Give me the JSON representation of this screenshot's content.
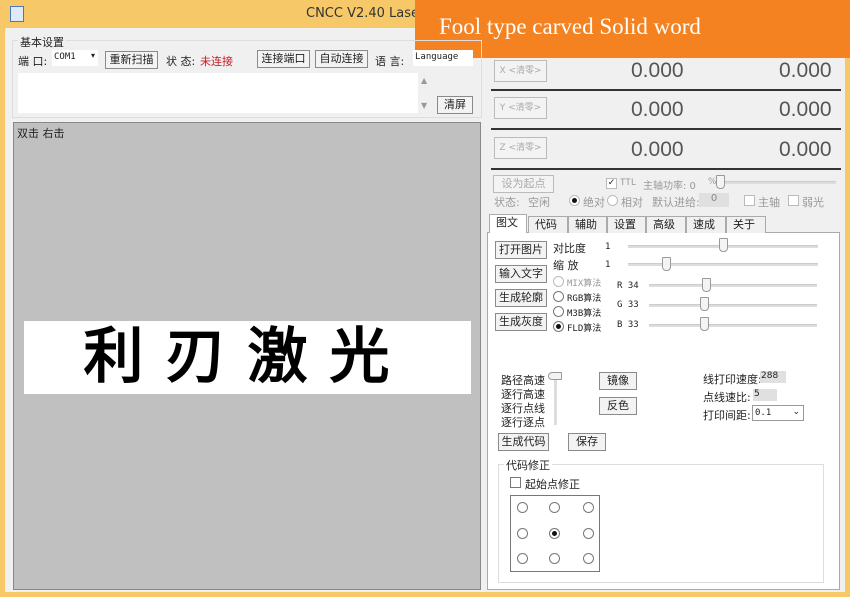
{
  "window": {
    "title": "CNCC V2.40  Laser"
  },
  "banner": {
    "text": "Fool type carved Solid  word"
  },
  "basic": {
    "group": "基本设置",
    "port_label": "端  口:",
    "port_value": "COM1",
    "rescan": "重新扫描",
    "status_label": "状  态:",
    "status_value": "未连接",
    "connect": "连接端口",
    "auto_connect": "自动连接",
    "lang_label": "语  言:",
    "lang_value": "Language",
    "clear": "清屏"
  },
  "canvas": {
    "hint": "双击 右击",
    "image_text": "利刃激光"
  },
  "coords": [
    {
      "axis": "X <清零>",
      "a": "0.000",
      "b": "0.000"
    },
    {
      "axis": "Y <清零>",
      "a": "0.000",
      "b": "0.000"
    },
    {
      "axis": "Z <清零>",
      "a": "0.000",
      "b": "0.000"
    }
  ],
  "control": {
    "set_origin": "设为起点",
    "ttl": "TTL",
    "spindle_power": "主轴功率: 0",
    "percent": "%",
    "state_label": "状态:",
    "state_value": "空闲",
    "absolute": "绝对",
    "relative": "相对",
    "default_feed": "默认进给:",
    "feed_value": "0",
    "spindle": "主轴",
    "weak_light": "弱光"
  },
  "tabs": [
    "图文",
    "代码",
    "辅助",
    "设置",
    "高级",
    "速成",
    "关于"
  ],
  "image_tab": {
    "open_image": "打开图片",
    "input_text": "输入文字",
    "gen_outline": "生成轮廓",
    "gen_gray": "生成灰度",
    "contrast_label": "对比度",
    "contrast_value": "1",
    "contrast_pos": 0.5,
    "scale_label": "缩  放",
    "scale_value": "1",
    "scale_pos": 0.2,
    "algos": [
      "MIX算法",
      "RGB算法",
      "M3B算法",
      "FLD算法"
    ],
    "selected_algo": "FLD算法",
    "r": "R 34",
    "g": "G 33",
    "b": "B 33",
    "r_val": 34,
    "g_val": 33,
    "b_val": 33,
    "speed_modes": [
      "路径高速",
      "逐行高速",
      "逐行点线",
      "逐行逐点"
    ],
    "mirror": "镜像",
    "invert": "反色",
    "line_speed_label": "线打印速度:",
    "line_speed": "288",
    "ratio_label": "点线速比:",
    "ratio": "5",
    "spacing_label": "打印间距:",
    "spacing": "0.1",
    "gen_code": "生成代码",
    "save": "保存",
    "fix_group": "代码修正",
    "start_fix": "起始点修正"
  }
}
